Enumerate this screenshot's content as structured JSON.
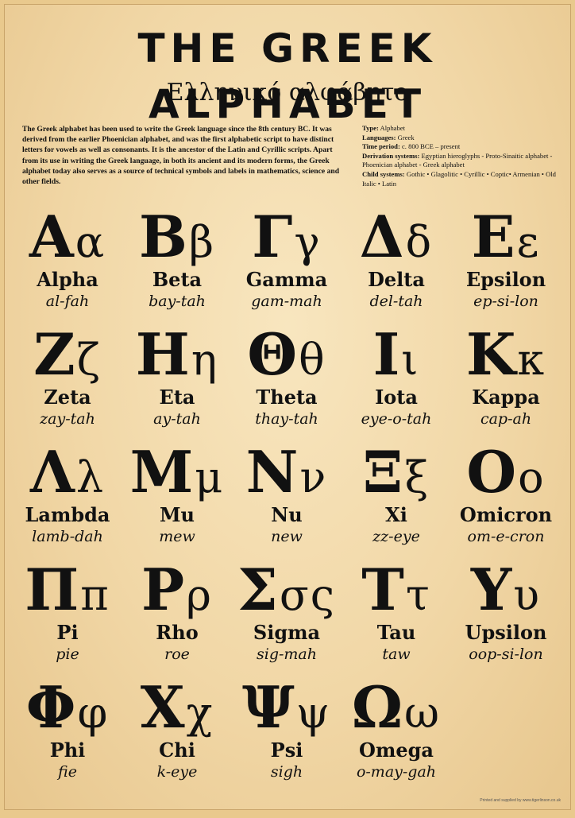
{
  "header": {
    "title": "THE GREEK ALPHABET",
    "subtitle": "Ελληνικό αλφάβητο"
  },
  "intro": "The Greek alphabet has been used to write the Greek language since the 8th century BC. It was derived from the earlier Phoenician alphabet, and was the first alphabetic script to have distinct letters for vowels as well as consonants. It is the ancestor of the Latin and Cyrillic scripts. Apart from its use in writing the Greek language, in both its ancient and its modern forms, the Greek alphabet today also serves as a source of technical symbols and labels in mathematics, science and other fields.",
  "info": [
    {
      "key": "Type:",
      "value": "Alphabet"
    },
    {
      "key": "Languages:",
      "value": "Greek"
    },
    {
      "key": "Time period:",
      "value": "c. 800 BCE – present"
    },
    {
      "key": "Derivation systems:",
      "value": "Egyptian hieroglyphs - Proto-Sinaitic alphabet - Phoenician alphabet - Greek alphabet"
    },
    {
      "key": "Child systems:",
      "value": "Gothic • Glagolitic • Cyrillic • Coptic• Armenian • Old Italic • Latin"
    }
  ],
  "letters": [
    {
      "upper": "Α",
      "lower": "α",
      "name": "Alpha",
      "pron": "al-fah"
    },
    {
      "upper": "Β",
      "lower": "β",
      "name": "Beta",
      "pron": "bay-tah"
    },
    {
      "upper": "Γ",
      "lower": "γ",
      "name": "Gamma",
      "pron": "gam-mah"
    },
    {
      "upper": "Δ",
      "lower": "δ",
      "name": "Delta",
      "pron": "del-tah"
    },
    {
      "upper": "Ε",
      "lower": "ε",
      "name": "Epsilon",
      "pron": "ep-si-lon"
    },
    {
      "upper": "Ζ",
      "lower": "ζ",
      "name": "Zeta",
      "pron": "zay-tah"
    },
    {
      "upper": "Η",
      "lower": "η",
      "name": "Eta",
      "pron": "ay-tah"
    },
    {
      "upper": "Θ",
      "lower": "θ",
      "name": "Theta",
      "pron": "thay-tah"
    },
    {
      "upper": "Ι",
      "lower": "ι",
      "name": "Iota",
      "pron": "eye-o-tah"
    },
    {
      "upper": "Κ",
      "lower": "κ",
      "name": "Kappa",
      "pron": "cap-ah"
    },
    {
      "upper": "Λ",
      "lower": "λ",
      "name": "Lambda",
      "pron": "lamb-dah"
    },
    {
      "upper": "Μ",
      "lower": "μ",
      "name": "Mu",
      "pron": "mew"
    },
    {
      "upper": "Ν",
      "lower": "ν",
      "name": "Nu",
      "pron": "new"
    },
    {
      "upper": "Ξ",
      "lower": "ξ",
      "name": "Xi",
      "pron": "zz-eye"
    },
    {
      "upper": "Ο",
      "lower": "ο",
      "name": "Omicron",
      "pron": "om-e-cron"
    },
    {
      "upper": "Π",
      "lower": "π",
      "name": "Pi",
      "pron": "pie"
    },
    {
      "upper": "Ρ",
      "lower": "ρ",
      "name": "Rho",
      "pron": "roe"
    },
    {
      "upper": "Σ",
      "lower": "σς",
      "name": "Sigma",
      "pron": "sig-mah"
    },
    {
      "upper": "Τ",
      "lower": "τ",
      "name": "Tau",
      "pron": "taw"
    },
    {
      "upper": "Υ",
      "lower": "υ",
      "name": "Upsilon",
      "pron": "oop-si-lon"
    },
    {
      "upper": "Φ",
      "lower": "φ",
      "name": "Phi",
      "pron": "fie"
    },
    {
      "upper": "Χ",
      "lower": "χ",
      "name": "Chi",
      "pron": "k-eye"
    },
    {
      "upper": "Ψ",
      "lower": "ψ",
      "name": "Psi",
      "pron": "sigh"
    },
    {
      "upper": "Ω",
      "lower": "ω",
      "name": "Omega",
      "pron": "o-may-gah"
    }
  ],
  "credit": "Printed and supplied by www.tigerlinson.co.uk"
}
